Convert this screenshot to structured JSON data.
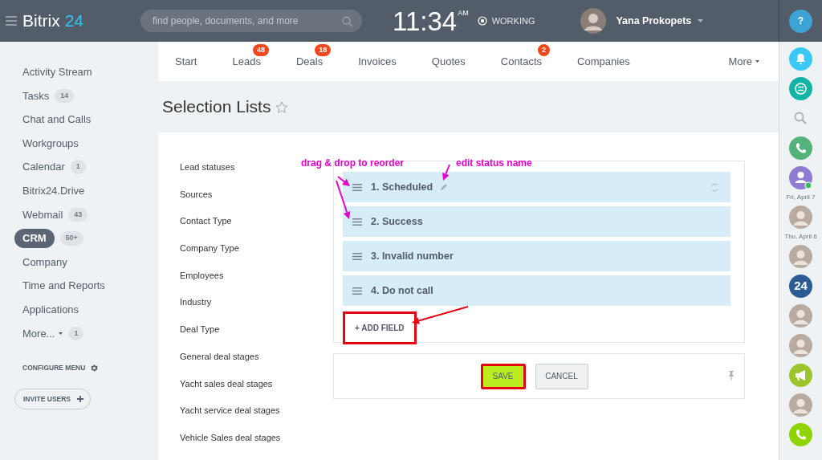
{
  "header": {
    "logo": {
      "name": "Bitrix",
      "number": "24"
    },
    "search": {
      "placeholder": "find people, documents, and more"
    },
    "clock": {
      "time": "11:34",
      "meridiem": "AM"
    },
    "work_status": "WORKING",
    "user": {
      "name": "Yana Prokopets"
    },
    "help": "?"
  },
  "sidebar": {
    "items": [
      {
        "label": "Activity Stream",
        "kind": "link",
        "selected": false
      },
      {
        "label": "Tasks",
        "counter": "14",
        "kind": "link",
        "selected": false
      },
      {
        "label": "Chat and Calls",
        "kind": "link",
        "selected": false
      },
      {
        "label": "Workgroups",
        "kind": "link",
        "selected": false
      },
      {
        "label": "Calendar",
        "counter": "1",
        "kind": "link",
        "selected": false
      },
      {
        "label": "Bitrix24.Drive",
        "kind": "link",
        "selected": false
      },
      {
        "label": "Webmail",
        "counter": "43",
        "kind": "link",
        "selected": false
      },
      {
        "label": "CRM",
        "counter": "50+",
        "kind": "link",
        "selected": true
      },
      {
        "label": "Company",
        "kind": "link",
        "selected": false
      },
      {
        "label": "Time and Reports",
        "kind": "link",
        "selected": false
      },
      {
        "label": "Applications",
        "kind": "link",
        "selected": false
      },
      {
        "label": "More...",
        "counter": "1",
        "kind": "menu",
        "selected": false
      }
    ],
    "configure": "CONFIGURE MENU",
    "invite": "INVITE USERS"
  },
  "tabs": [
    {
      "label": "Start"
    },
    {
      "label": "Leads",
      "counter": "48"
    },
    {
      "label": "Deals",
      "counter": "18"
    },
    {
      "label": "Invoices"
    },
    {
      "label": "Quotes"
    },
    {
      "label": "Contacts",
      "counter": "2"
    },
    {
      "label": "Companies"
    }
  ],
  "more_tab": "More",
  "page_title": "Selection Lists",
  "categories": [
    "Lead statuses",
    "Sources",
    "Contact Type",
    "Company Type",
    "Employees",
    "Industry",
    "Deal Type",
    "General deal stages",
    "Yacht sales deal stages",
    "Yacht service deal stages",
    "Vehicle Sales deal stages"
  ],
  "statuses": [
    {
      "label": "1. Scheduled",
      "editable": true
    },
    {
      "label": "2. Success",
      "editable": false
    },
    {
      "label": "3. Invalid number",
      "editable": false
    },
    {
      "label": "4. Do not call",
      "editable": false
    }
  ],
  "add_field": {
    "label": "+ ADD FIELD",
    "highlighted": true
  },
  "buttons": [
    {
      "label": "SAVE",
      "kind": "primary",
      "highlighted": true
    },
    {
      "label": "CANCEL",
      "kind": "secondary",
      "highlighted": false
    }
  ],
  "annotations": [
    {
      "text": "drag & drop to reorder"
    },
    {
      "text": "edit status name"
    }
  ],
  "right_bar": [
    {
      "kind": "bell",
      "color": "#3bc8f5"
    },
    {
      "kind": "chat",
      "color": "#12b5a5"
    },
    {
      "kind": "search"
    },
    {
      "kind": "phone",
      "color": "#55b27b"
    },
    {
      "kind": "contact",
      "color": "#8f7bd0"
    },
    {
      "kind": "date",
      "text": "Fri, April 7"
    },
    {
      "kind": "avatar"
    },
    {
      "kind": "date",
      "text": "Thu, April 6"
    },
    {
      "kind": "avatar"
    },
    {
      "kind": "badge",
      "text": "24",
      "color": "#2d5b94"
    },
    {
      "kind": "avatar"
    },
    {
      "kind": "avatar"
    },
    {
      "kind": "megaphone",
      "color": "#9dc42d"
    },
    {
      "kind": "avatar"
    },
    {
      "kind": "phone",
      "color": "#8fd400"
    }
  ]
}
